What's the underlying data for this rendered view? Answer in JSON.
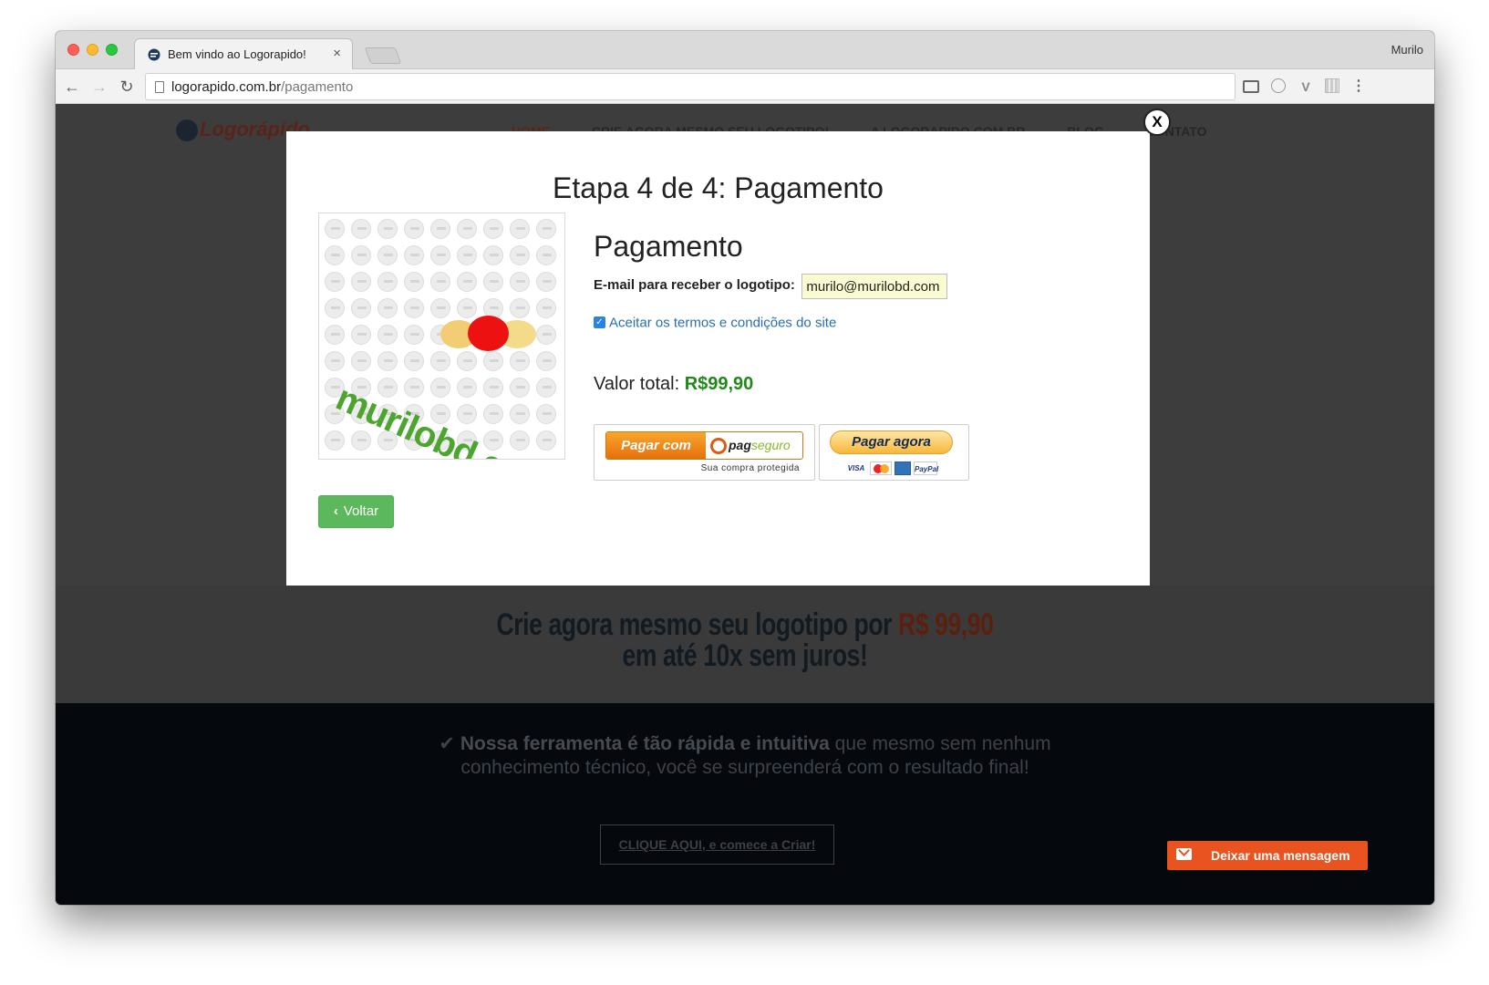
{
  "browser": {
    "tab_title": "Bem vindo ao Logorapido!",
    "tab_close": "×",
    "profile_name": "Murilo",
    "url_domain": "logorapido.com.br",
    "url_path": "/pagamento"
  },
  "site": {
    "logo_text": "Logorápido",
    "nav": [
      "HOME",
      "CRIE AGORA MESMO SEU LOGOTIPO!",
      "A LOGORAPIDO.COM.BR",
      "BLOG",
      "CONTATO"
    ],
    "promo": {
      "line1_prefix": "Crie agora mesmo seu logotipo por ",
      "price": "R$ 99,90",
      "line2": "em até 10x sem juros!"
    },
    "features": {
      "check": "✔",
      "bold": "Nossa ferramenta é tão rápida e intuitiva",
      "rest_line1": " que mesmo sem nenhum",
      "rest_line2": "conhecimento técnico, você se surpreenderá com o resultado final!"
    },
    "cta": {
      "link": "CLIQUE AQUI",
      "rest": ", e comece a Criar!"
    },
    "chat_button": "Deixar uma mensagem"
  },
  "modal": {
    "close": "X",
    "title": "Etapa 4 de 4: Pagamento",
    "preview_text": "murilobd.com",
    "heading": "Pagamento",
    "email_label": "E-mail para receber o logotipo:",
    "email_value": "murilo@murilobd.com",
    "terms_label": "Aceitar os termos e condições do site",
    "terms_checked": true,
    "total_label": "Valor total:",
    "total_value": "R$99,90",
    "pagseguro": {
      "left": "Pagar com",
      "brand_a": "pag",
      "brand_b": "seguro",
      "tagline": "Sua compra protegida"
    },
    "paypal": {
      "button": "Pagar agora",
      "cards": [
        "VISA",
        "",
        "",
        "PayPal"
      ]
    },
    "back_button": "Voltar",
    "back_icon": "chevron-left-icon"
  },
  "colors": {
    "overlay_bg": "#3b3b3b",
    "total_green": "#1f8a18",
    "link_blue": "#2b6ea9",
    "back_green": "#5cb85c",
    "chat_orange": "#e8531f",
    "pagseguro_orange": "#f39a1f",
    "paypal_gold": "#f7b83a",
    "logo_green": "#4ba52e"
  }
}
